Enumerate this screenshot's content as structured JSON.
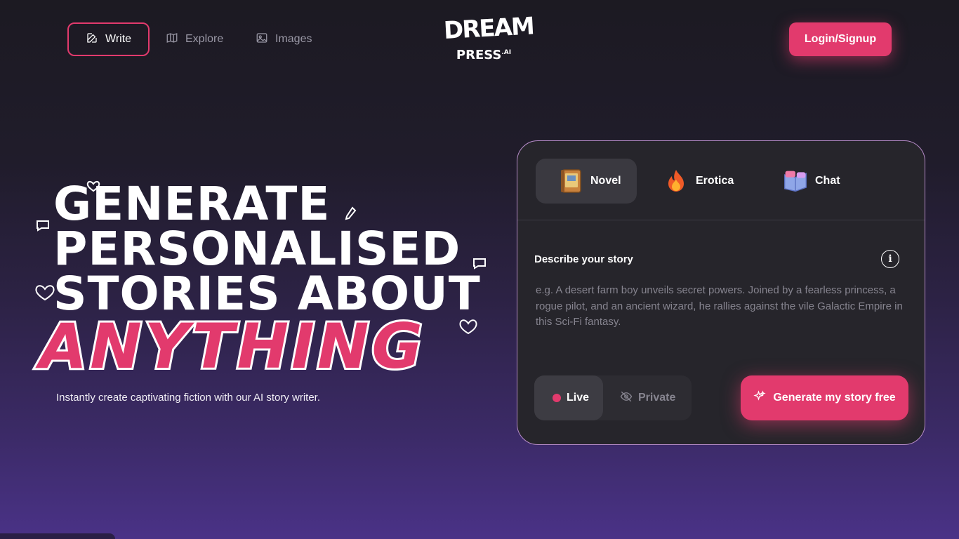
{
  "nav": {
    "write_label": "Write",
    "explore_label": "Explore",
    "images_label": "Images",
    "login_label": "Login/Signup"
  },
  "logo": {
    "line1": "DREAM",
    "line2": "PRESS",
    "suffix": ".AI"
  },
  "hero": {
    "line1": "GENERATE",
    "line2": "PERSONALISED",
    "line3": "STORIES ABOUT",
    "highlight": "ANYTHING",
    "subtitle": "Instantly create captivating fiction with our AI story writer."
  },
  "card": {
    "tabs": [
      {
        "label": "Novel",
        "icon": "book-icon"
      },
      {
        "label": "Erotica",
        "icon": "fire-icon"
      },
      {
        "label": "Chat",
        "icon": "chat-book-icon"
      }
    ],
    "describe_label": "Describe your story",
    "info_glyph": "i",
    "placeholder": "e.g. A desert farm boy unveils secret powers. Joined by a fearless princess, a rogue pilot, and an ancient wizard, he rallies against the vile Galactic Empire in this Sci-Fi fantasy.",
    "visibility": {
      "live_label": "Live",
      "private_label": "Private"
    },
    "generate_label": "Generate my story free"
  },
  "colors": {
    "accent": "#e23a6d",
    "card_bg": "#26252b",
    "card_border": "#b48ac6"
  }
}
